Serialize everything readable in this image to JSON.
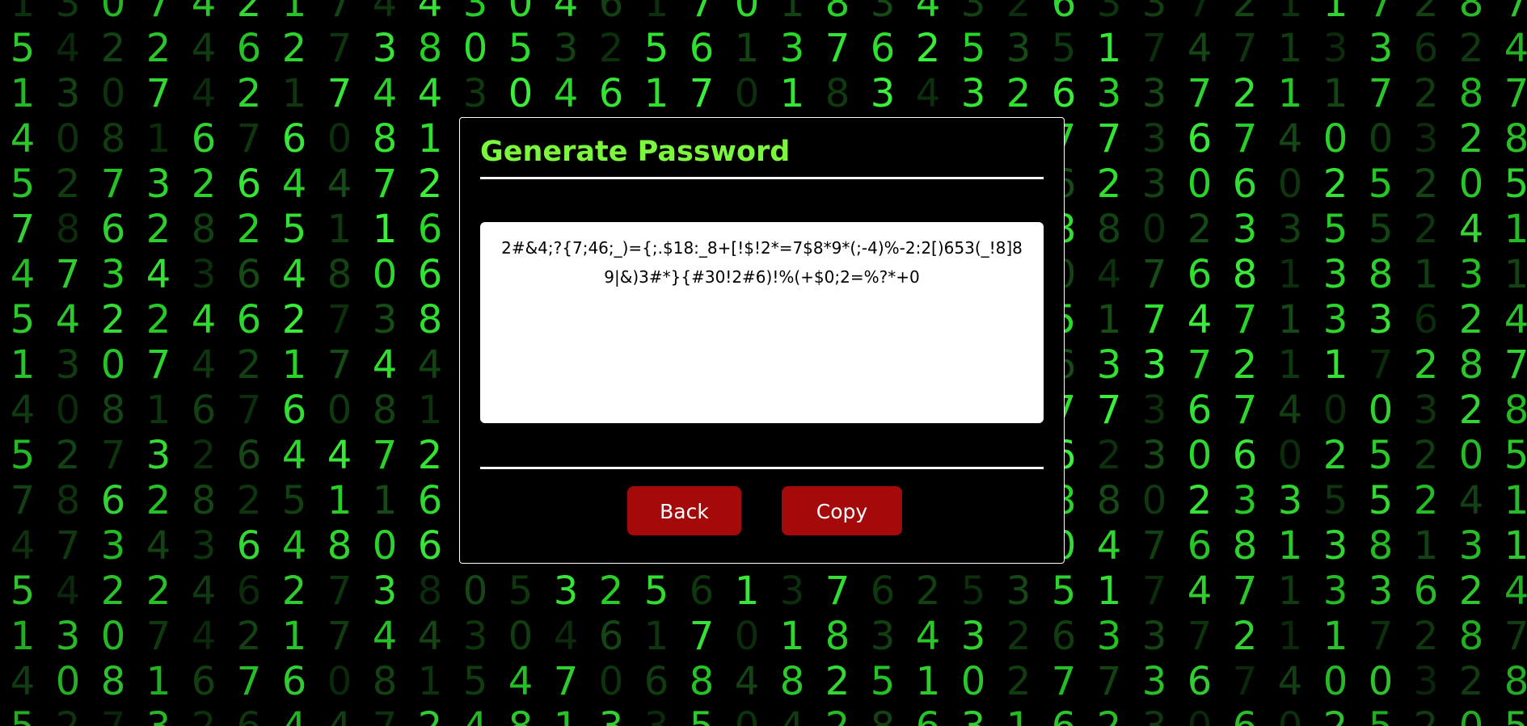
{
  "dialog": {
    "title": "Generate Password",
    "password": "2#&4;?{7;46;_)={;.$18:_8+[!$!2*=7$8*9*(;-4)%-2:2[)653(_!8]89|&)3#*}{#30!2#6)!%(+$0;2=%?*+0"
  },
  "buttons": {
    "back_label": "Back",
    "copy_label": "Copy"
  },
  "background": {
    "icon": "matrix-digit-rain",
    "accent_color": "#2ee82e",
    "rows": [
      "1 3 0 7 4 2 1 7 4 4 3 0 4 6 1 7 0 1 8 3 4 3 2 6 3 3 7 2 1 1 7 2 8 7",
      "5 4 2 2 4 6 2 7 3 8 0 5 3 2 5 6 1 3 7 6 2 5 3 5 1 7 4 7 1 3 3 6 2 4",
      "1 3 0 7 4 2 1 7 4 4 3 0 4 6 1 7 0 1 8 3 4 3 2 6 3 3 7 2 1 1 7 2 8 7",
      "4 0 8 1 6 7 6 0 8 1 5 4 7 0 6 8 4 8 2 5 1 0 2 7 7 3 6 7 4 0 0 3 2 8",
      "5 2 7 3 2 6 4 4 7 2 4 8 1 3 3 5 0 4 2 8 6 3 1 6 2 3 0 6 0 2 5 2 0 5",
      "7 8 6 2 8 2 5 1 1 6 5 0 7 2 4 7 2 1 3 8 6 5 3 8 8 0 2 3 3 5 5 2 4 1",
      "4 7 3 4 3 6 4 8 0 6 7 3 1 5 0 2 4 3 1 7 5 5 1 0 4 7 6 8 1 3 8 1 3 1",
      "5 4 2 2 4 6 2 7 3 8 0 5 3 2 5 6 1 3 7 6 2 5 3 5 1 7 4 7 1 3 3 6 2 4",
      "1 3 0 7 4 2 1 7 4 4 3 0 4 6 1 7 0 1 8 3 4 3 2 6 3 3 7 2 1 1 7 2 8 7",
      "4 0 8 1 6 7 6 0 8 1 5 4 7 0 6 8 4 8 2 5 1 0 2 7 7 3 6 7 4 0 0 3 2 8",
      "5 2 7 3 2 6 4 4 7 2 4 8 1 3 3 5 0 4 2 8 6 3 1 6 2 3 0 6 0 2 5 2 0 5",
      "7 8 6 2 8 2 5 1 1 6 5 0 7 2 4 7 2 1 3 8 6 5 3 8 8 0 2 3 3 5 5 2 4 1",
      "4 7 3 4 3 6 4 8 0 6 7 3 1 5 0 2 4 3 1 7 5 5 1 0 4 7 6 8 1 3 8 1 3 1",
      "5 4 2 2 4 6 2 7 3 8 0 5 3 2 5 6 1 3 7 6 2 5 3 5 1 7 4 7 1 3 3 6 2 4",
      "1 3 0 7 4 2 1 7 4 4 3 0 4 6 1 7 0 1 8 3 4 3 2 6 3 3 7 2 1 1 7 2 8 7",
      "4 0 8 1 6 7 6 0 8 1 5 4 7 0 6 8 4 8 2 5 1 0 2 7 7 3 6 7 4 0 0 3 2 8",
      "5 2 7 3 2 6 4 4 7 2 4 8 1 3 3 5 0 4 2 8 6 3 1 6 2 3 0 6 0 2 5 2 0 5"
    ]
  }
}
